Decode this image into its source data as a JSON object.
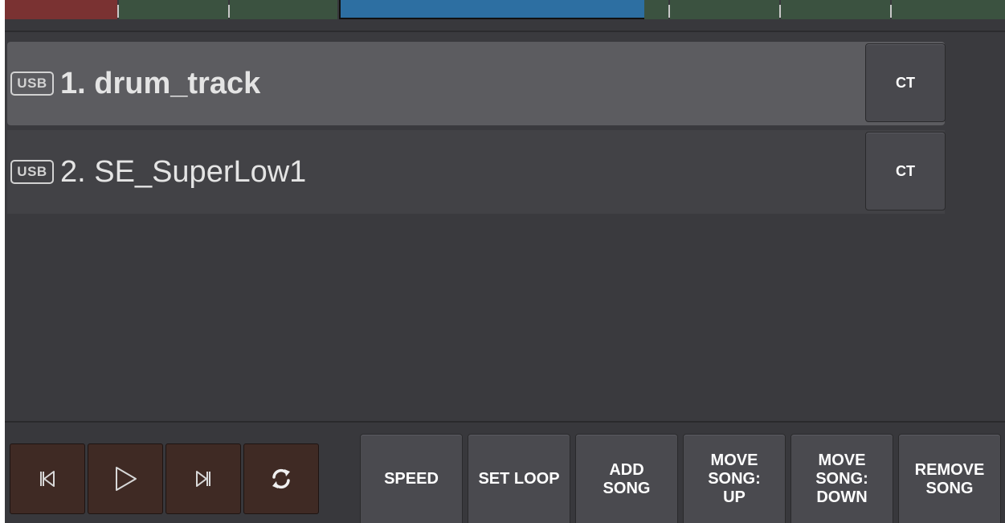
{
  "song_list": {
    "items": [
      {
        "badge": "USB",
        "title": "1. drum_track",
        "ct_label": "CT",
        "selected": true
      },
      {
        "badge": "USB",
        "title": "2. SE_SuperLow1",
        "ct_label": "CT",
        "selected": false
      }
    ]
  },
  "transport": {
    "prev_icon": "skip-previous-icon",
    "play_icon": "play-icon",
    "next_icon": "skip-next-icon",
    "loop_icon": "repeat-icon"
  },
  "actions": {
    "speed": "SPEED",
    "set_loop": "SET LOOP",
    "add_song": "ADD\nSONG",
    "move_up": "MOVE\nSONG:\nUP",
    "move_down": "MOVE\nSONG:\nDOWN",
    "remove_song": "REMOVE\nSONG"
  },
  "colors": {
    "background": "#3a3a3e",
    "selected_row": "#5c5c60",
    "transport_button": "#3f2a24",
    "home_tab": "#7a3232",
    "preview_bar": "#2d6fa2"
  }
}
